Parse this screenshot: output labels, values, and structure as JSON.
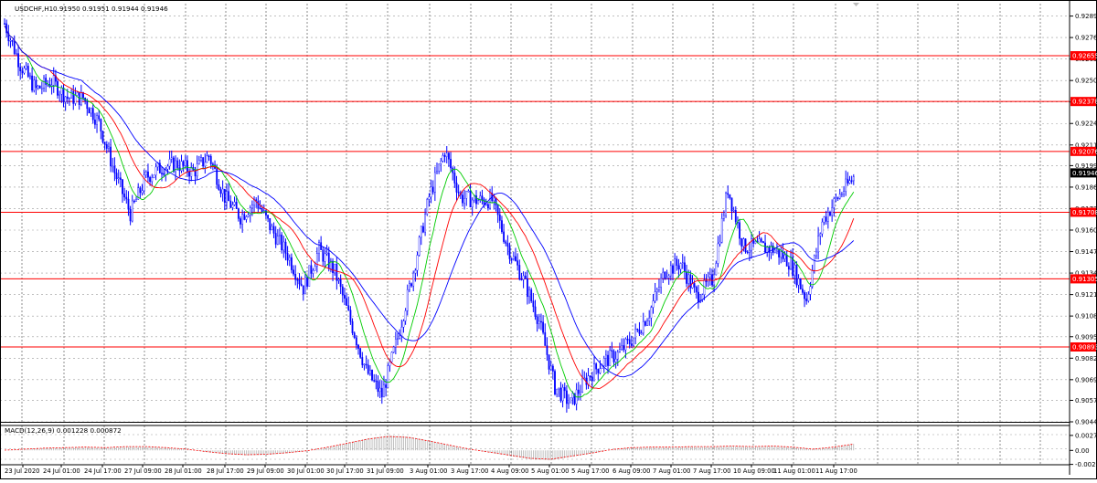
{
  "header": {
    "symbol": "USDCHF,H1",
    "ohlc": "0.91950 0.91951 0.91944 0.91946"
  },
  "macd": {
    "label": "MACD(12,26,9) 0.001228 0.000872",
    "ticks": [
      "0.002725",
      "0.00",
      "-0.002535"
    ]
  },
  "colors": {
    "candle": "#0000ff",
    "level": "#ff0000",
    "ma_fast": "#00cc00",
    "ma_mid": "#ff0000",
    "ma_slow": "#0000ff",
    "grid": "#c8c8c8",
    "badge_red": "#ff0000",
    "badge_current": "#000000"
  },
  "chart_data": {
    "type": "line",
    "title": "USDCHF,H1",
    "ylim": [
      0.9044,
      0.9297
    ],
    "price_ticks": [
      "0.92895",
      "0.92765",
      "0.92635",
      "0.92505",
      "0.92375",
      "0.92245",
      "0.92115",
      "0.91990",
      "0.91860",
      "0.91730",
      "0.91600",
      "0.91470",
      "0.91340",
      "0.91210",
      "0.91080",
      "0.90955",
      "0.90825",
      "0.90695",
      "0.90570",
      "0.90440"
    ],
    "x_labels": [
      "23 Jul 2020",
      "24 Jul 01:00",
      "24 Jul 17:00",
      "27 Jul 09:00",
      "28 Jul 01:00",
      "28 Jul 17:00",
      "29 Jul 09:00",
      "30 Jul 01:00",
      "30 Jul 17:00",
      "31 Jul 09:00",
      "3 Aug 01:00",
      "3 Aug 17:00",
      "4 Aug 09:00",
      "5 Aug 01:00",
      "5 Aug 17:00",
      "6 Aug 09:00",
      "7 Aug 01:00",
      "7 Aug 17:00",
      "10 Aug 09:00",
      "11 Aug 01:00",
      "11 Aug 17:00"
    ],
    "levels": [
      "0.92655",
      "0.92378",
      "0.92076",
      "0.91708",
      "0.91305",
      "0.90893"
    ],
    "current_price": "0.91946",
    "close_path": [
      0.9285,
      0.926,
      0.9245,
      0.925,
      0.924,
      0.924,
      0.9225,
      0.9195,
      0.917,
      0.9192,
      0.9198,
      0.92,
      0.9195,
      0.9205,
      0.918,
      0.9168,
      0.9178,
      0.916,
      0.9145,
      0.9125,
      0.9148,
      0.9135,
      0.9105,
      0.9075,
      0.906,
      0.9095,
      0.9135,
      0.918,
      0.9208,
      0.918,
      0.9178,
      0.9178,
      0.915,
      0.913,
      0.9105,
      0.9065,
      0.9055,
      0.907,
      0.908,
      0.9085,
      0.9095,
      0.911,
      0.9135,
      0.914,
      0.912,
      0.913,
      0.9185,
      0.915,
      0.915,
      0.9148,
      0.914,
      0.9118,
      0.9165,
      0.918,
      0.9192
    ],
    "macd_path": [
      0,
      0.0002,
      0.0004,
      0.0005,
      0.0006,
      0.0005,
      0.0007,
      0.0007,
      0.0005,
      0.0002,
      -0.0003,
      -0.0007,
      -0.0009,
      -0.0008,
      -0.0005,
      -0.0001,
      0.0006,
      0.0014,
      0.0022,
      0.0027,
      0.0025,
      0.0018,
      0.001,
      0.0002,
      -0.0004,
      -0.001,
      -0.0016,
      -0.0018,
      -0.0012,
      -0.0006,
      0.0001,
      0.0005,
      0.0006,
      0.0006,
      0.0007,
      0.0007,
      0.0008,
      0.0007,
      0.0008,
      0.0006,
      0.0002,
      0.0006,
      0.0012
    ],
    "date_range": [
      "23 Jul 2020",
      "11 Aug 17:00"
    ]
  }
}
